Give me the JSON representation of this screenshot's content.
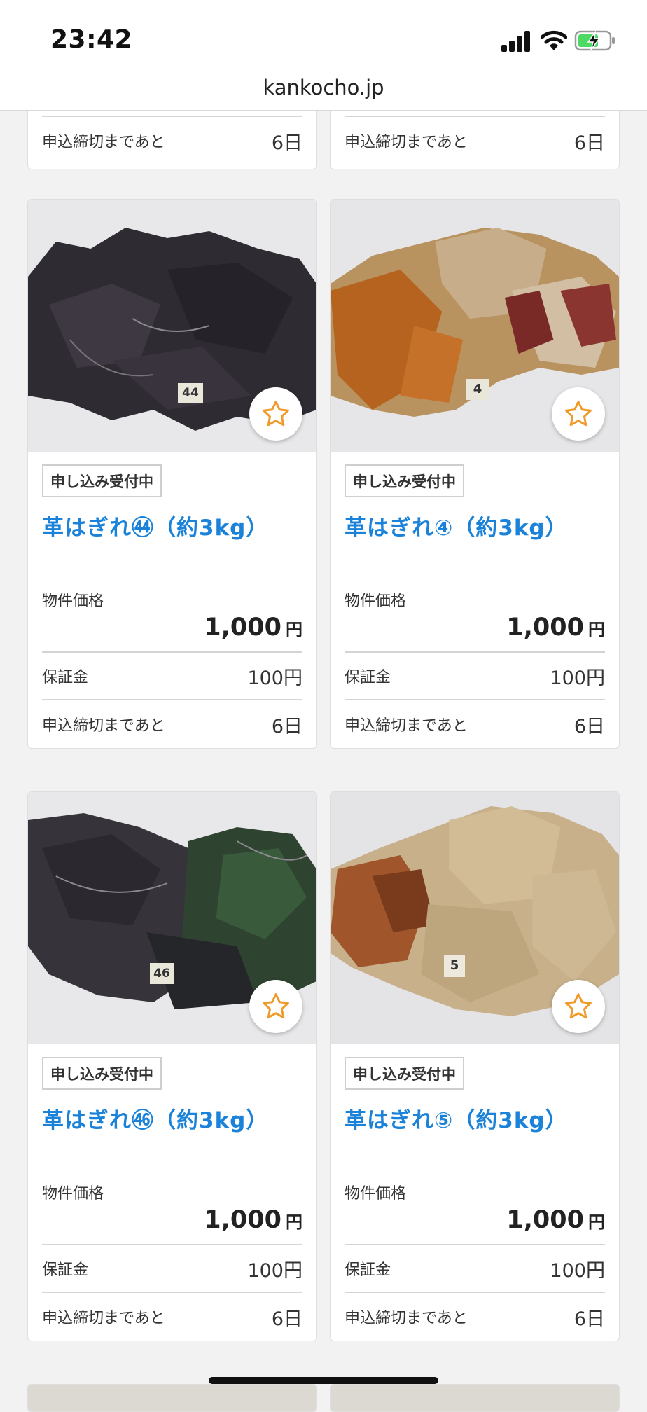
{
  "status_bar": {
    "time": "23:42"
  },
  "browser": {
    "url": "kankocho.jp"
  },
  "partial_top": [
    {
      "deadline_label": "申込締切まであと",
      "deadline_value": "6日"
    },
    {
      "deadline_label": "申込締切まであと",
      "deadline_value": "6日"
    }
  ],
  "items": [
    {
      "number_tag": "44",
      "badge": "申し込み受付中",
      "title": "革はぎれ㊹（約3kg）",
      "price_label": "物件価格",
      "price": "1,000",
      "price_unit": "円",
      "deposit_label": "保証金",
      "deposit_value": "100円",
      "deadline_label": "申込締切まであと",
      "deadline_value": "6日",
      "tone": "dark"
    },
    {
      "number_tag": "4",
      "badge": "申し込み受付中",
      "title": "革はぎれ④（約3kg）",
      "price_label": "物件価格",
      "price": "1,000",
      "price_unit": "円",
      "deposit_label": "保証金",
      "deposit_value": "100円",
      "deadline_label": "申込締切まであと",
      "deadline_value": "6日",
      "tone": "brown"
    },
    {
      "number_tag": "46",
      "badge": "申し込み受付中",
      "title": "革はぎれ㊻（約3kg）",
      "price_label": "物件価格",
      "price": "1,000",
      "price_unit": "円",
      "deposit_label": "保証金",
      "deposit_value": "100円",
      "deadline_label": "申込締切まであと",
      "deadline_value": "6日",
      "tone": "green"
    },
    {
      "number_tag": "5",
      "badge": "申し込み受付中",
      "title": "革はぎれ⑤（約3kg）",
      "price_label": "物件価格",
      "price": "1,000",
      "price_unit": "円",
      "deposit_label": "保証金",
      "deposit_value": "100円",
      "deadline_label": "申込締切まであと",
      "deadline_value": "6日",
      "tone": "tan"
    }
  ],
  "colors": {
    "title_link": "#1a82d8",
    "favorite_star": "#f09a2a"
  },
  "icons": {
    "favorite": "star-outline-icon"
  }
}
